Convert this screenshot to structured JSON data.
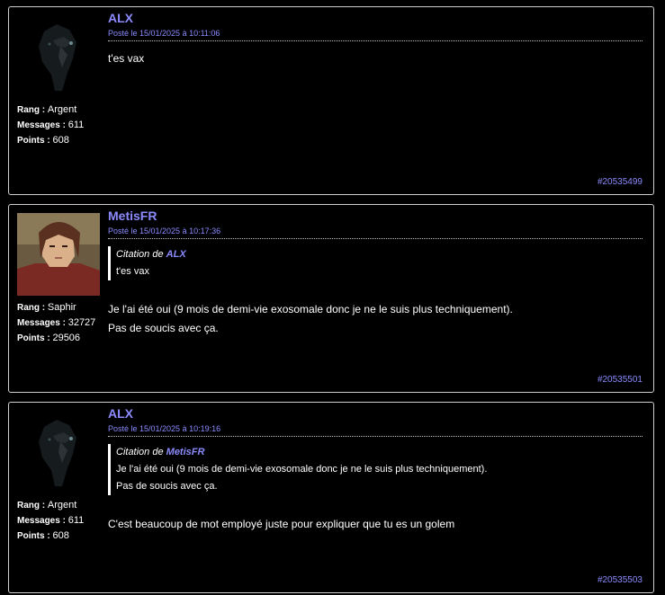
{
  "posts": [
    {
      "author": "ALX",
      "date": "Posté le 15/01/2025 à 10:11:06",
      "rank_label": "Rang :",
      "rank": "Argent",
      "messages_label": "Messages :",
      "messages": "611",
      "points_label": "Points :",
      "points": "608",
      "avatar_icon": "crow-avatar-icon",
      "quote": null,
      "body": [
        "t'es vax"
      ],
      "id": "#20535499"
    },
    {
      "author": "MetisFR",
      "date": "Posté le 15/01/2025 à 10:17:36",
      "rank_label": "Rang :",
      "rank": "Saphir",
      "messages_label": "Messages :",
      "messages": "32727",
      "points_label": "Points :",
      "points": "29506",
      "avatar_icon": "anime-character-avatar-icon",
      "quote": {
        "prefix": "Citation de",
        "author": "ALX",
        "lines": [
          "t'es vax"
        ]
      },
      "body": [
        "Je l'ai été oui (9 mois de demi-vie exosomale donc je ne le suis plus techniquement).",
        "Pas de soucis avec ça."
      ],
      "id": "#20535501"
    },
    {
      "author": "ALX",
      "date": "Posté le 15/01/2025 à 10:19:16",
      "rank_label": "Rang :",
      "rank": "Argent",
      "messages_label": "Messages :",
      "messages": "611",
      "points_label": "Points :",
      "points": "608",
      "avatar_icon": "crow-avatar-icon",
      "quote": {
        "prefix": "Citation de",
        "author": "MetisFR",
        "lines": [
          "Je l'ai été oui (9 mois de demi-vie exosomale donc je ne le suis plus techniquement).",
          "Pas de soucis avec ça."
        ]
      },
      "body": [
        "C'est beaucoup de mot employé juste pour expliquer que tu es un golem"
      ],
      "id": "#20535503"
    }
  ],
  "colors": {
    "accent": "#8b8bff",
    "background": "#000000",
    "border": "#cfcfcf",
    "text": "#ffffff"
  }
}
